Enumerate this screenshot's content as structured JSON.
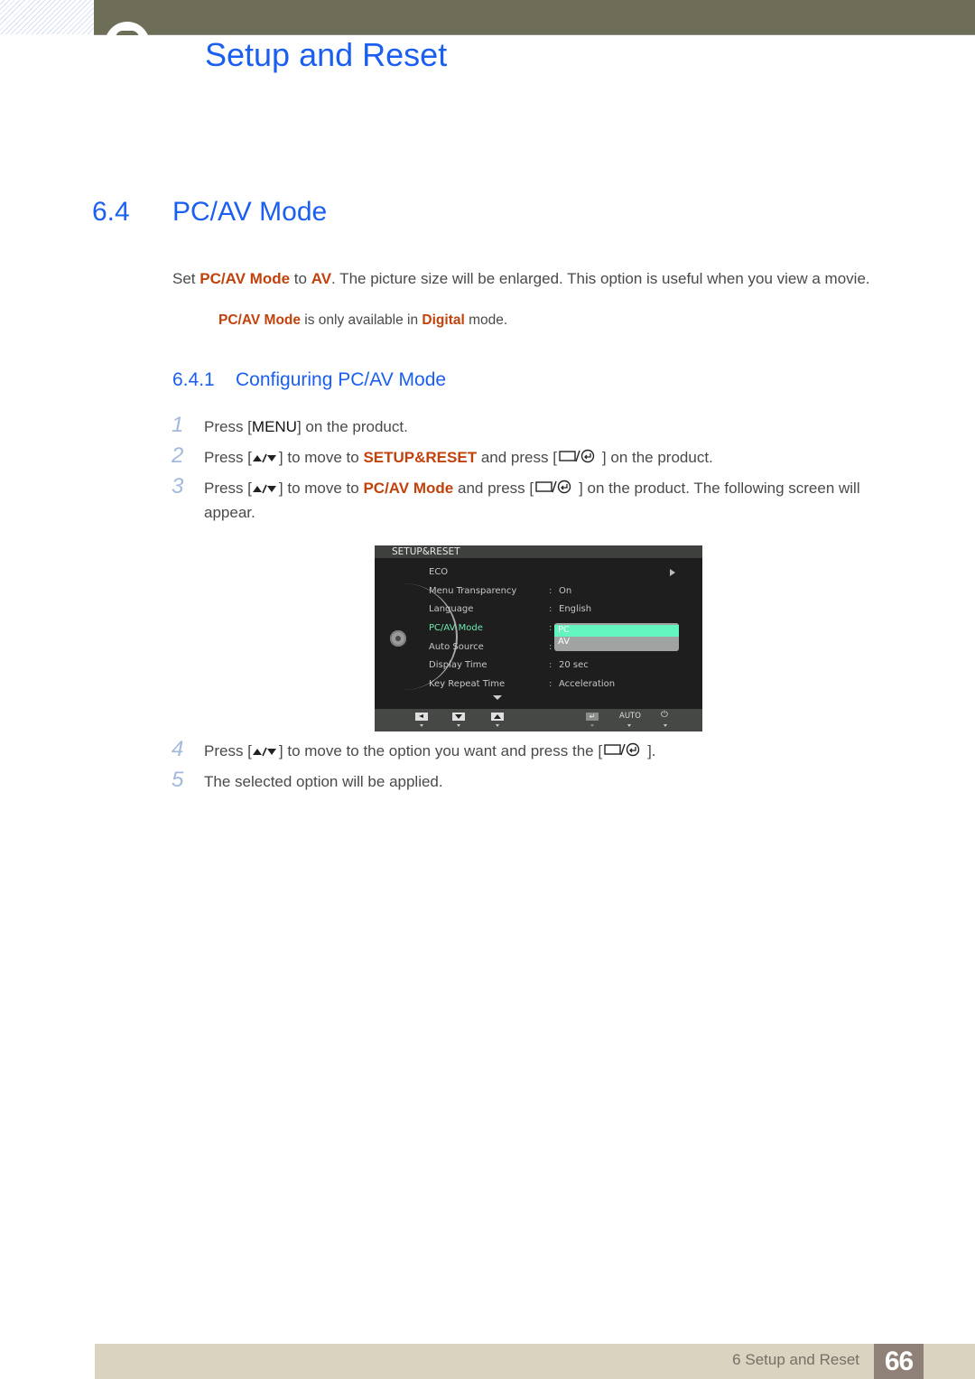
{
  "header": {
    "chapter_title": "Setup and Reset"
  },
  "section": {
    "number": "6.4",
    "title": "PC/AV Mode",
    "intro": {
      "pre": "Set ",
      "hl1": "PC/AV Mode",
      "mid": " to ",
      "hl2": "AV",
      "post": ". The picture size will be enlarged. This option is useful when you view a movie."
    },
    "note": {
      "hl1": "PC/AV Mode",
      "mid": " is only available in ",
      "hl2": "Digital",
      "post": " mode."
    }
  },
  "subsection": {
    "number": "6.4.1",
    "title": "Configuring PC/AV Mode"
  },
  "steps": [
    {
      "num": "1",
      "pre": "Press [",
      "key": "MENU",
      "post": "] on the product."
    },
    {
      "num": "2",
      "pre": "Press [",
      "mid1": "] to move to ",
      "hl": "SETUP&RESET",
      "mid2": " and press [",
      "post": "] on the product."
    },
    {
      "num": "3",
      "pre": "Press [",
      "mid1": "] to move to ",
      "hl": "PC/AV Mode",
      "mid2": " and press [",
      "post": "] on the product. The following screen will",
      "line2": "appear."
    },
    {
      "num": "4",
      "pre": "Press [",
      "mid1": "] to move to the option you want and press the [",
      "post": "]."
    },
    {
      "num": "5",
      "text": "The selected option will be applied."
    }
  ],
  "osd": {
    "title": "SETUP&RESET",
    "items": [
      {
        "label": "ECO",
        "value": ""
      },
      {
        "label": "Menu Transparency",
        "value": "On"
      },
      {
        "label": "Language",
        "value": "English"
      },
      {
        "label": "PC/AV Mode",
        "value": ""
      },
      {
        "label": "Auto Source",
        "value": ""
      },
      {
        "label": "Display Time",
        "value": "20 sec"
      },
      {
        "label": "Key Repeat Time",
        "value": "Acceleration"
      }
    ],
    "dropdown": {
      "options": [
        "PC",
        "AV"
      ],
      "selected": "PC"
    },
    "footer": {
      "auto_label": "AUTO",
      "power_glyph": "⏻",
      "enter_glyph": "↵"
    },
    "colors": {
      "active": "#6ee9b0",
      "selected_bg": "#62f5bd"
    }
  },
  "footer": {
    "chapter": "6 Setup and Reset",
    "page": "66"
  },
  "colors": {
    "heading_blue": "#1a5ff0",
    "highlight": "#c0420c",
    "step_number": "#a3b9dc",
    "topbar": "#6e6d58",
    "footer_bg": "#d9d3c0",
    "page_badge": "#8f8178"
  }
}
